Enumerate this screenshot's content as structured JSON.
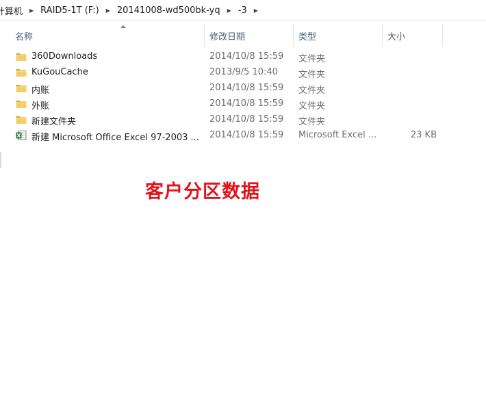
{
  "breadcrumb": {
    "items": [
      "计算机",
      "RAID5-1T (F:)",
      "20141008-wd500bk-yq",
      "-3"
    ]
  },
  "columns": {
    "name": "名称",
    "date": "修改日期",
    "type": "类型",
    "size": "大小"
  },
  "files": [
    {
      "name": "360Downloads",
      "date": "2014/10/8 15:59",
      "type": "文件夹",
      "size": "",
      "icon": "folder-icon"
    },
    {
      "name": "KuGouCache",
      "date": "2013/9/5 10:40",
      "type": "文件夹",
      "size": "",
      "icon": "folder-icon"
    },
    {
      "name": "内账",
      "date": "2014/10/8 15:59",
      "type": "文件夹",
      "size": "",
      "icon": "folder-icon"
    },
    {
      "name": "外账",
      "date": "2014/10/8 15:59",
      "type": "文件夹",
      "size": "",
      "icon": "folder-icon"
    },
    {
      "name": "新建文件夹",
      "date": "2014/10/8 15:59",
      "type": "文件夹",
      "size": "",
      "icon": "folder-icon"
    },
    {
      "name": "新建 Microsoft Office Excel 97-2003 ...",
      "date": "2014/10/8 15:59",
      "type": "Microsoft Excel ...",
      "size": "23 KB",
      "icon": "excel-file-icon"
    }
  ],
  "overlay": {
    "text": "客户分区数据"
  },
  "colors": {
    "overlay_text": "#e3121b",
    "header_text": "#4c607a",
    "folder": "#e8c25b",
    "excel": "#1d7a3c"
  }
}
